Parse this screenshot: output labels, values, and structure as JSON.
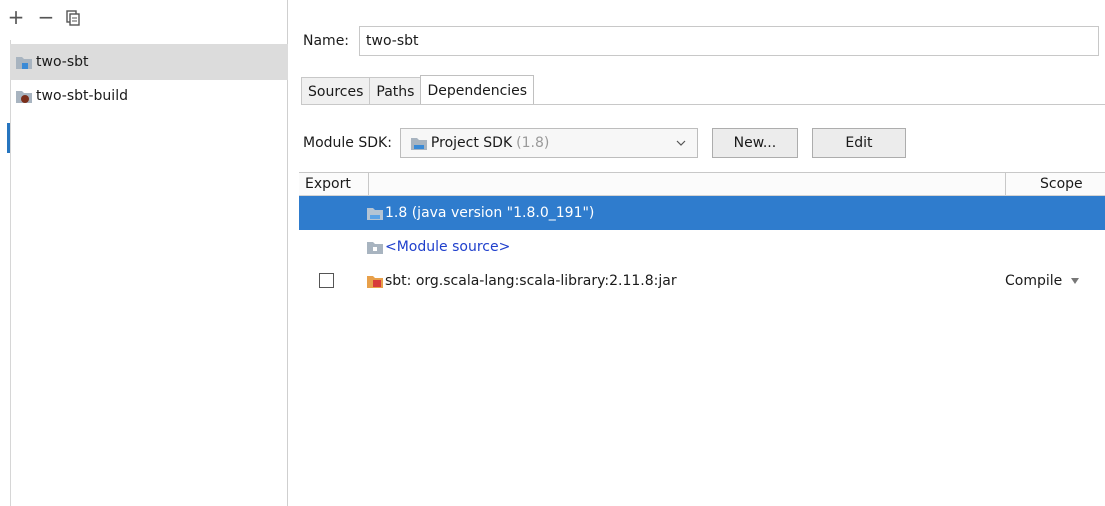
{
  "toolbar": {
    "add": "+",
    "remove": "−"
  },
  "modules": [
    {
      "label": "two-sbt"
    },
    {
      "label": "two-sbt-build"
    }
  ],
  "name_field": {
    "label": "Name:",
    "value": "two-sbt"
  },
  "tabs": [
    {
      "label": "Sources"
    },
    {
      "label": "Paths"
    },
    {
      "label": "Dependencies"
    }
  ],
  "sdk": {
    "label": "Module SDK:",
    "selected": "Project SDK",
    "version": "(1.8)",
    "new_button": "New...",
    "edit_button": "Edit"
  },
  "table": {
    "col_export": "Export",
    "col_scope": "Scope",
    "rows": [
      {
        "text": "1.8 (java version \"1.8.0_191\")"
      },
      {
        "text": "<Module source>"
      },
      {
        "text": "sbt: org.scala-lang:scala-library:2.11.8:jar",
        "scope": "Compile"
      }
    ]
  },
  "colors": {
    "selection": "#2f7ccd",
    "module_source_link": "#1f3fcc",
    "left_marker": "#2675bf"
  }
}
